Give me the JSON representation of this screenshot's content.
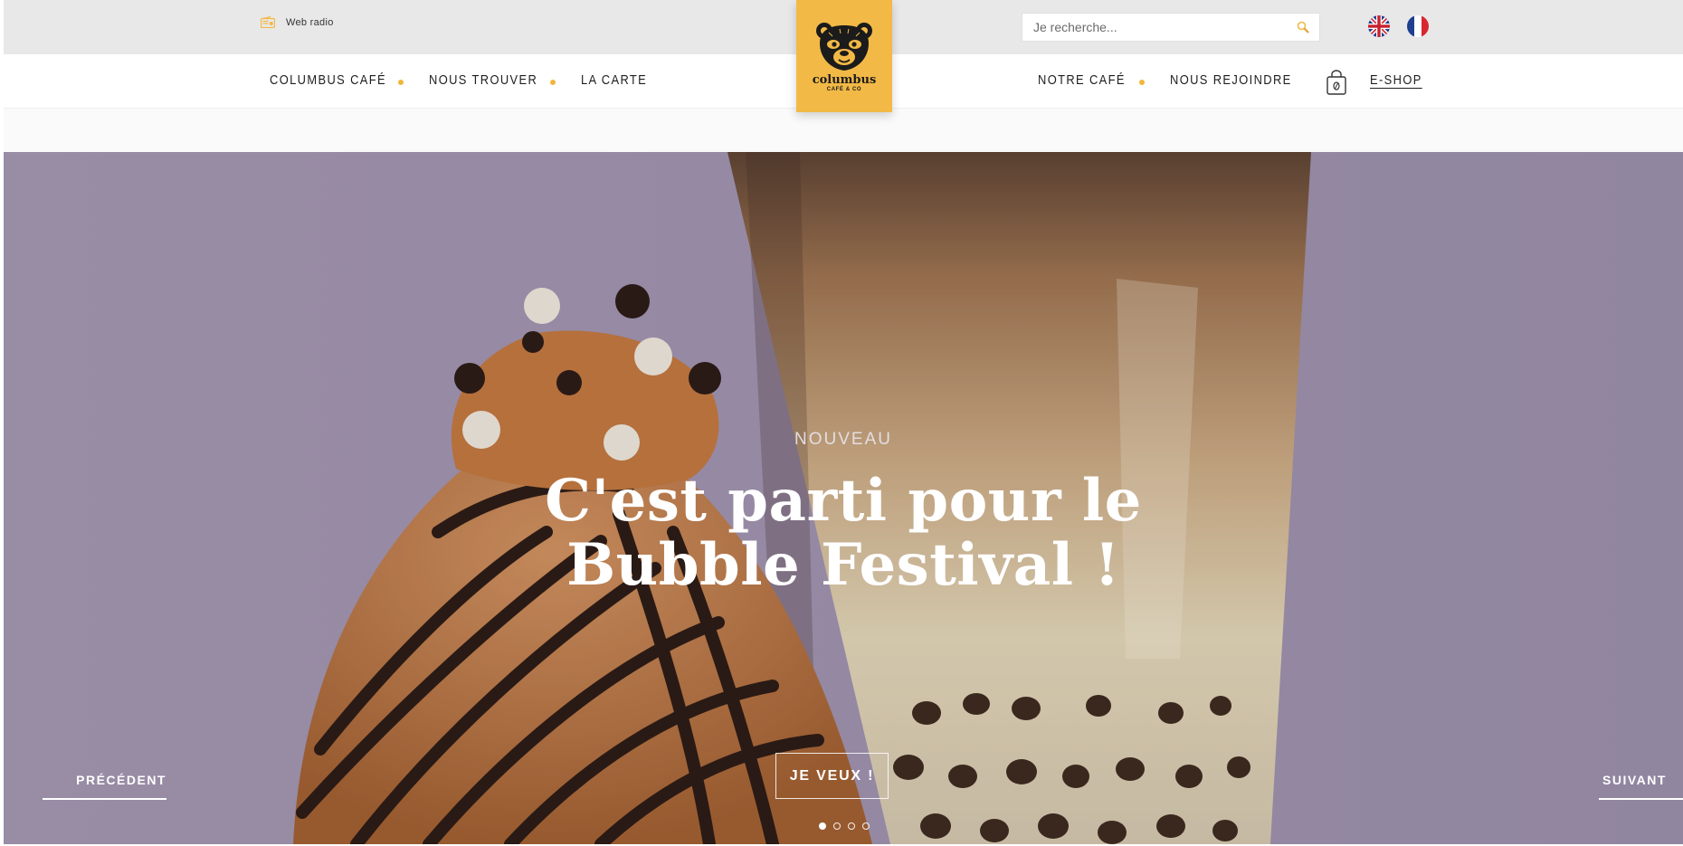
{
  "topbar": {
    "web_radio_label": "Web radio",
    "search_placeholder": "Je recherche...",
    "languages": [
      "en",
      "fr"
    ]
  },
  "logo": {
    "name": "columbus",
    "subtitle": "CAFÉ & CO"
  },
  "nav": {
    "left": [
      "COLUMBUS CAFÉ",
      "NOUS TROUVER",
      "LA CARTE"
    ],
    "right": [
      "NOTRE CAFÉ",
      "NOUS REJOINDRE"
    ],
    "eshop": "E-SHOP"
  },
  "hero": {
    "eyebrow": "NOUVEAU",
    "title_line1": "C'est parti pour le",
    "title_line2": "Bubble Festival !",
    "cta": "JE VEUX !",
    "prev": "PRÉCÉDENT",
    "next": "SUIVANT",
    "slides_total": 4,
    "active_slide": 1
  },
  "colors": {
    "accent": "#f2b946",
    "topbar": "#e8e8e8",
    "hero_bg": "#a497b1"
  },
  "icons": [
    "radio-icon",
    "search-icon",
    "uk-flag-icon",
    "fr-flag-icon",
    "shopping-bag-icon",
    "bear-logo-icon"
  ]
}
